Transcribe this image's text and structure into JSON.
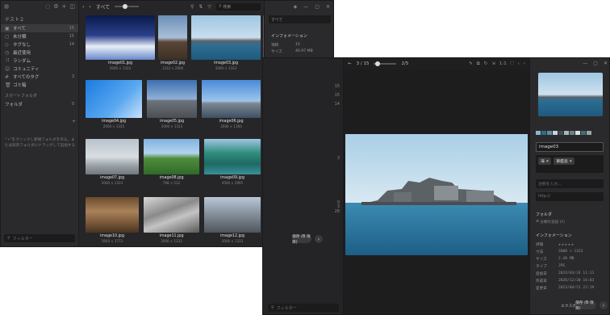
{
  "win1": {
    "library_title": "テスト２",
    "nav": [
      {
        "label": "すべて",
        "count": "15",
        "icon": "▣"
      },
      {
        "label": "未分類",
        "count": "15",
        "icon": "▢"
      },
      {
        "label": "タグなし",
        "count": "14",
        "icon": "◇"
      },
      {
        "label": "最近使用",
        "count": "",
        "icon": "◷"
      },
      {
        "label": "ランダム",
        "count": "",
        "icon": "⤨"
      },
      {
        "label": "コミュニティ",
        "count": "",
        "icon": "☺"
      },
      {
        "label": "すべてのタグ",
        "count": "3",
        "icon": "#"
      },
      {
        "label": "ゴミ箱",
        "count": "",
        "icon": "🗑"
      }
    ],
    "smart_folder": "スマートフォルダ",
    "folder": "フォルダ",
    "folder_count": "0",
    "hint": "\"+\"をクリックし新規フォルダを作る。または既存フォルダにドラッグして追加する",
    "filter_placeholder": "フィルター",
    "toolbar_title": "すべて",
    "search_placeholder": "検索",
    "images": [
      {
        "name": "image01.jpg",
        "dim": "2000 × 1333"
      },
      {
        "name": "image02.jpg",
        "dim": "1333 × 2000"
      },
      {
        "name": "image03.jpg",
        "dim": "2000 × 1333"
      },
      {
        "name": "image04.jpg",
        "dim": "2000 × 1335"
      },
      {
        "name": "image05.jpg",
        "dim": "2000 × 1333"
      },
      {
        "name": "image06.jpg",
        "dim": "2000 × 1160"
      },
      {
        "name": "image07.jpg",
        "dim": "2000 × 1333"
      },
      {
        "name": "image08.jpg",
        "dim": "768 × 512"
      },
      {
        "name": "image09.jpg",
        "dim": "4500 × 2995"
      },
      {
        "name": "image10.jpg",
        "dim": "5664 × 3773"
      },
      {
        "name": "image11.jpg",
        "dim": "2000 × 1333"
      },
      {
        "name": "image12.jpg",
        "dim": "2000 × 1333"
      }
    ],
    "right_panel": {
      "field": "すべて",
      "info_title": "インフォメーション",
      "rows": [
        {
          "k": "項目",
          "v": "15"
        },
        {
          "k": "サイズ",
          "v": "46.97 MB"
        }
      ]
    }
  },
  "win2": {
    "counts": [
      "15",
      "15",
      "14",
      "3",
      "0",
      "3",
      "28"
    ],
    "filter_placeholder": "フィルター",
    "pager": "3 / 15",
    "zoom": "1:1",
    "slider_label": "2/5",
    "image_name": "image03",
    "palette": [
      "#8fb4c4",
      "#2e6d86",
      "#5a8ea3",
      "#c5d6dc",
      "#3f4d55",
      "#a6b8bd",
      "#6f7f84",
      "#d8e0e2",
      "#4b6a78",
      "#9aa5a8"
    ],
    "tags": [
      "海",
      "軍艦島"
    ],
    "notes_placeholder": "注釈を入力...",
    "url_placeholder": "http://",
    "folder_title": "フォルダ",
    "add_to_folder": "分類の追加 (F)",
    "info_title": "インフォメーション",
    "rows": [
      {
        "k": "評価",
        "v": "★★★★★"
      },
      {
        "k": "寸法",
        "v": "2000 × 1333"
      },
      {
        "k": "サイズ",
        "v": "2.48 MB"
      },
      {
        "k": "タイプ",
        "v": "JPG"
      },
      {
        "k": "追加日",
        "v": "2024/03/24 11:11"
      },
      {
        "k": "作成日",
        "v": "2020/12/30 16:03"
      },
      {
        "k": "変更日",
        "v": "2023/04/21 22:19"
      }
    ],
    "export_label": "エクスポ",
    "export_btn": "保存 (B 項目)",
    "win1_btn": "保存 (B 項目)"
  }
}
